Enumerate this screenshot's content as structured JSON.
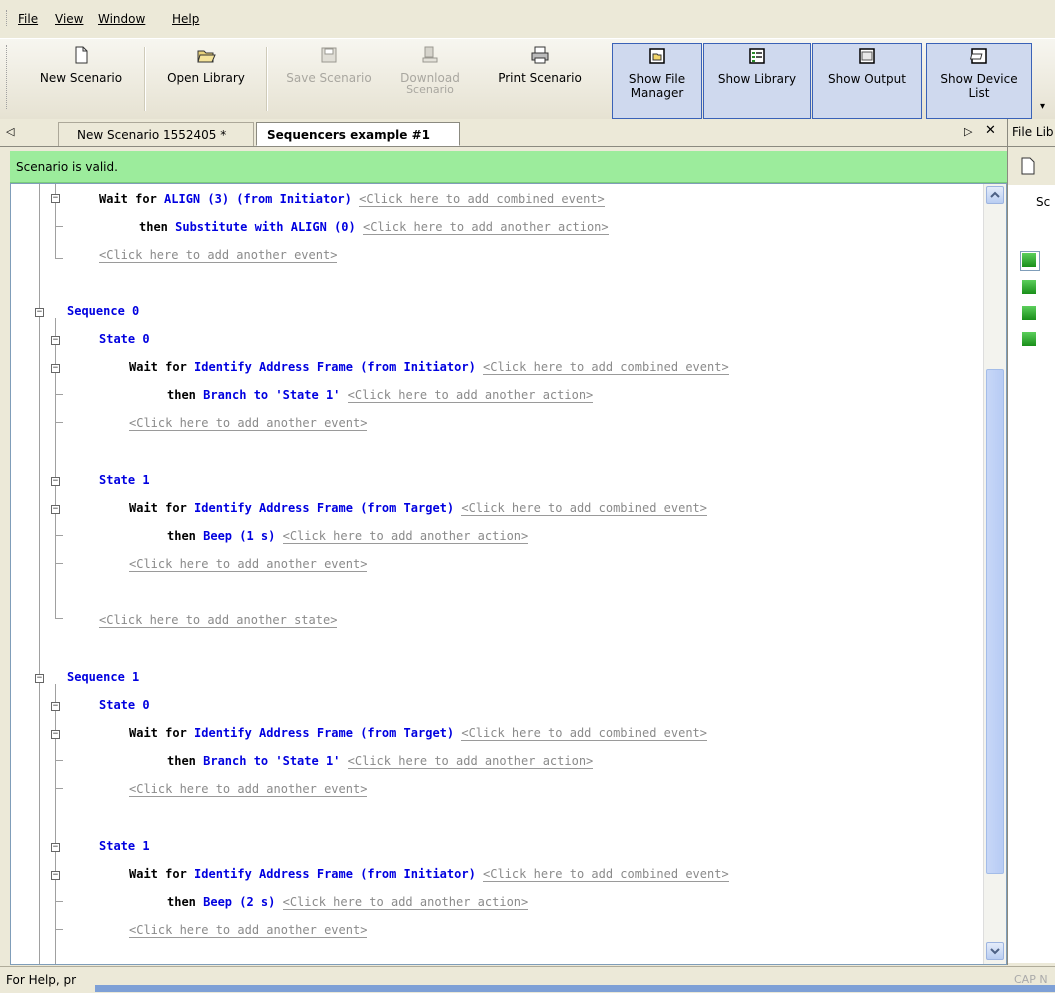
{
  "menu": {
    "file": "File",
    "view": "View",
    "window": "Window",
    "help": "Help"
  },
  "toolbar": {
    "new_scenario": "New Scenario",
    "open_library": "Open Library",
    "save_scenario": "Save Scenario",
    "download_line1": "Download",
    "download_line2": "Scenario",
    "print_scenario": "Print Scenario",
    "show_file_line1": "Show File",
    "show_file_line2": "Manager",
    "show_library": "Show Library",
    "show_output": "Show Output",
    "show_device_line1": "Show Device",
    "show_device_line2": "List"
  },
  "tabs": {
    "tab1": "New Scenario 1552405 *",
    "tab2": "Sequencers example #1"
  },
  "right_panel": {
    "title": "File Lib",
    "col": "Sc"
  },
  "status": {
    "valid": "Scenario is valid.",
    "help": "For Help, pr",
    "right": "CAP N"
  },
  "editor": {
    "l1": {
      "a": "Wait for ",
      "b": "ALIGN (3) (from Initiator)",
      "h": "<Click here to add combined event>"
    },
    "l2": {
      "a": "then ",
      "b": "Substitute with ALIGN (0)",
      "h": "<Click here to add another action>"
    },
    "l3": {
      "h": "<Click here to add another event>"
    },
    "seq0": "Sequence 0",
    "s0_state0": "State 0",
    "s0_st0_wait": {
      "a": "Wait for ",
      "b": "Identify Address Frame (from Initiator)",
      "h": "<Click here to add combined event>"
    },
    "s0_st0_then": {
      "a": "then ",
      "b": "Branch to 'State 1'",
      "h": "<Click here to add another action>"
    },
    "s0_st0_event": "<Click here to add another event>",
    "s0_state1": "State 1",
    "s0_st1_wait": {
      "a": "Wait for ",
      "b": "Identify Address Frame (from Target)",
      "h": "<Click here to add combined event>"
    },
    "s0_st1_then": {
      "a": "then ",
      "b": "Beep (1 s)",
      "h": "<Click here to add another action>"
    },
    "s0_st1_event": "<Click here to add another event>",
    "s0_add_state": "<Click here to add another state>",
    "seq1": "Sequence 1",
    "s1_state0": "State 0",
    "s1_st0_wait": {
      "a": "Wait for ",
      "b": "Identify Address Frame (from Target)",
      "h": "<Click here to add combined event>"
    },
    "s1_st0_then": {
      "a": "then ",
      "b": "Branch to 'State 1'",
      "h": "<Click here to add another action>"
    },
    "s1_st0_event": "<Click here to add another event>",
    "s1_state1": "State 1",
    "s1_st1_wait": {
      "a": "Wait for ",
      "b": "Identify Address Frame (from Initiator)",
      "h": "<Click here to add combined event>"
    },
    "s1_st1_then": {
      "a": "then ",
      "b": "Beep (2 s)",
      "h": "<Click here to add another action>"
    },
    "s1_st1_event": "<Click here to add another event>"
  }
}
